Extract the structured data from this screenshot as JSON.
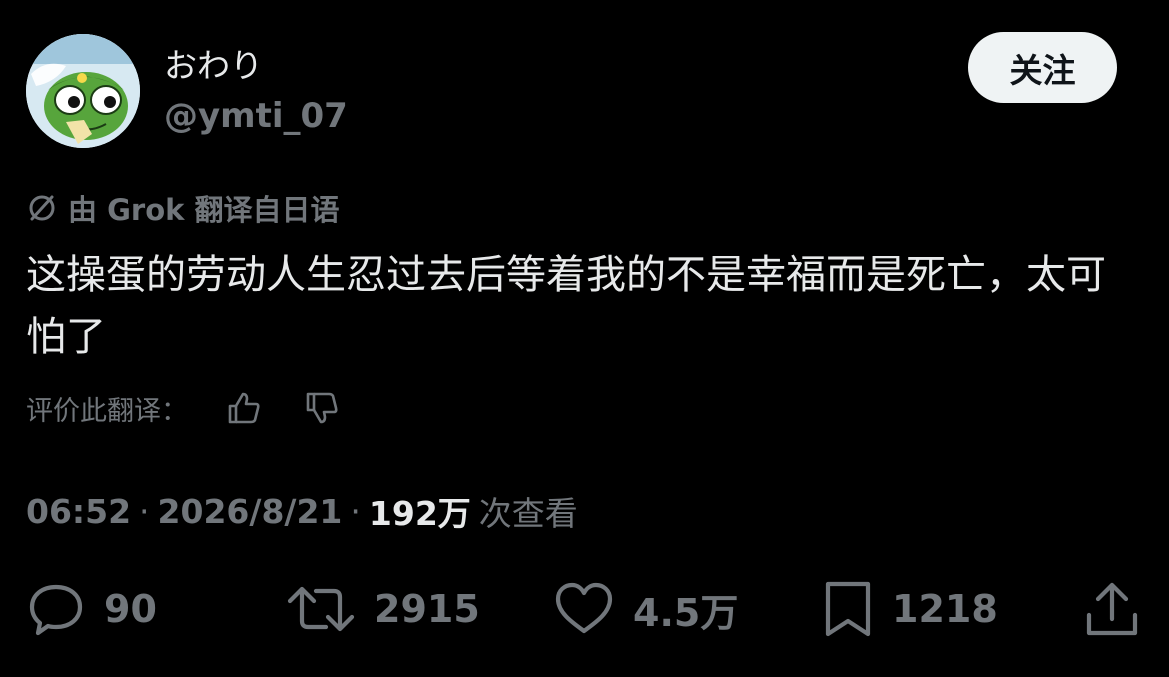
{
  "user": {
    "display_name": "おわり",
    "handle": "@ymti_07",
    "avatar_icon": "keroro-avatar-icon"
  },
  "follow_button_label": "关注",
  "translation": {
    "icon": "translate-icon",
    "note": "由 Grok 翻译自日语"
  },
  "tweet": {
    "text": "这操蛋的劳动人生忍过去后等着我的不是幸福而是死亡，太可怕了"
  },
  "rating": {
    "label": "评价此翻译：",
    "thumbs_up_icon": "thumbs-up-icon",
    "thumbs_down_icon": "thumbs-down-icon"
  },
  "meta": {
    "time": "06:52",
    "separator": "·",
    "date": "2026/8/21",
    "views_count": "192万",
    "views_label": "次查看"
  },
  "actions": {
    "reply": {
      "icon": "reply-icon",
      "count": "90"
    },
    "repost": {
      "icon": "repost-icon",
      "count": "2915"
    },
    "like": {
      "icon": "heart-icon",
      "count": "4.5万"
    },
    "bookmark": {
      "icon": "bookmark-icon",
      "count": "1218"
    },
    "share": {
      "icon": "share-icon"
    }
  },
  "colors": {
    "background": "#000000",
    "primary_text": "#e7e9ea",
    "secondary_text": "#71767b",
    "follow_bg": "#eff3f4",
    "follow_text": "#0f1419"
  }
}
